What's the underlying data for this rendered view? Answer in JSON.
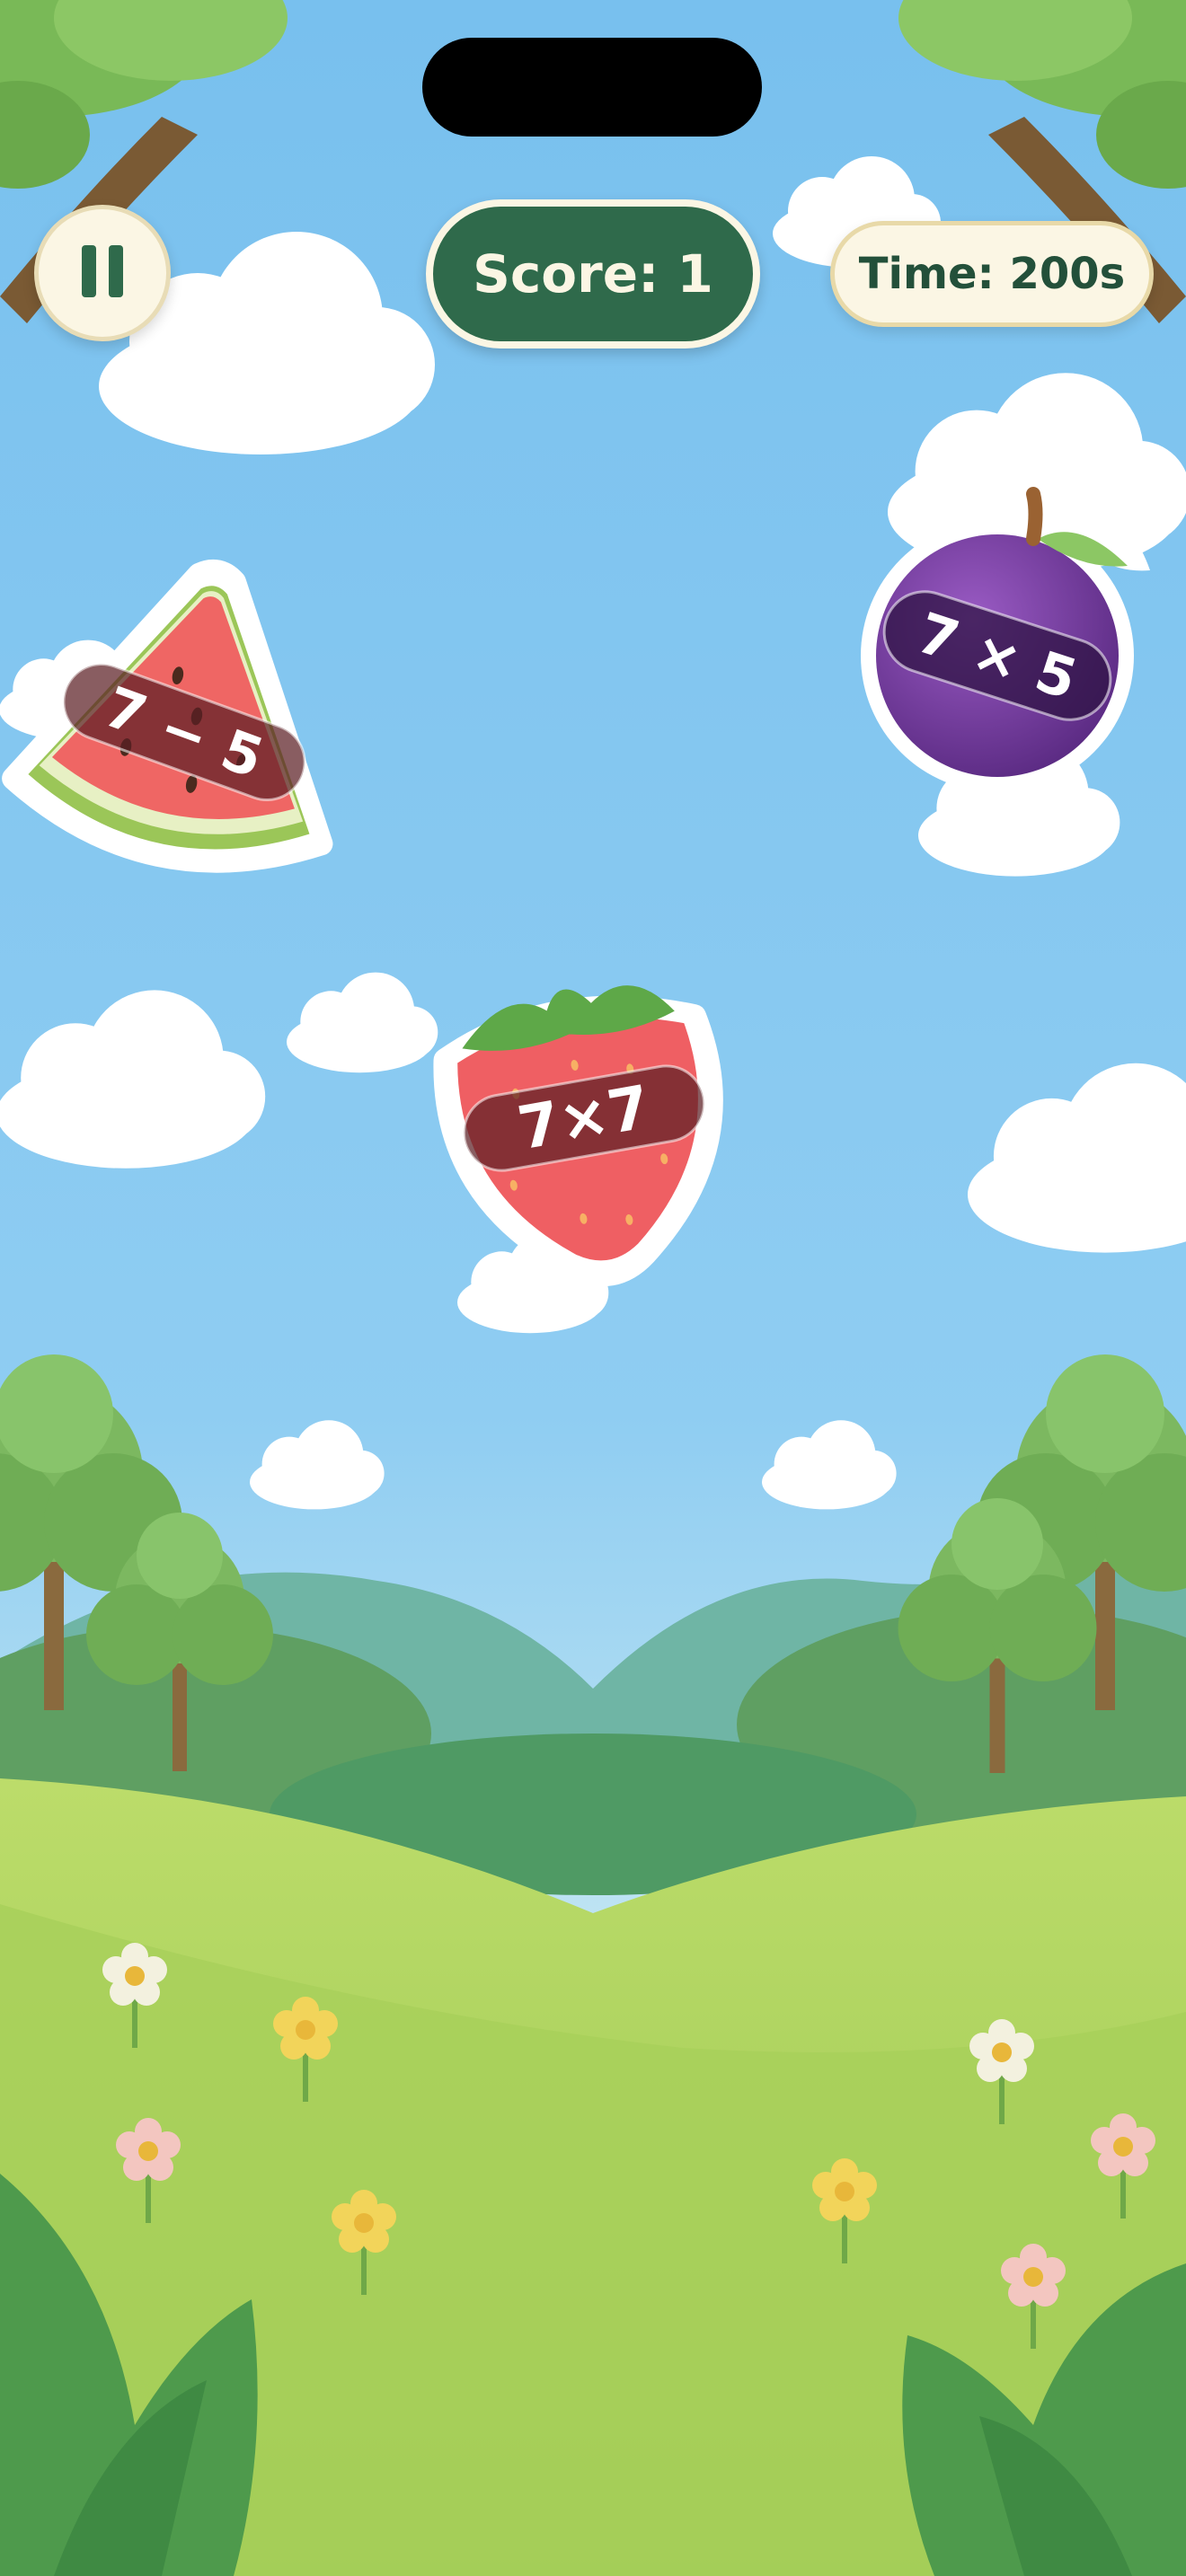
{
  "hud": {
    "score_text": "Score: 1",
    "time_text": "Time: 200s"
  },
  "fruits": [
    {
      "kind": "watermelon",
      "expression": "7 − 5"
    },
    {
      "kind": "plum",
      "expression": "7 × 5"
    },
    {
      "kind": "strawberry",
      "expression": "7×7"
    }
  ],
  "icons": {
    "pause": "pause-icon"
  },
  "colors": {
    "sky_top": "#7ec3ef",
    "sky_bottom": "#bfe4f5",
    "hud_green": "#2f6a4b",
    "hud_cream": "#fbf6e4",
    "grass": "#a9d35c"
  }
}
